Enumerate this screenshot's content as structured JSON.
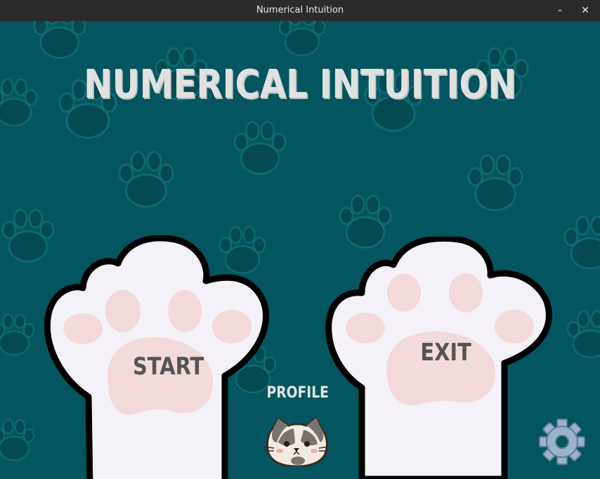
{
  "window": {
    "title": "Numerical Intuition",
    "minimize_label": "–",
    "close_label": "✕"
  },
  "game": {
    "title": "NUMERICAL INTUITION",
    "start_label": "START",
    "exit_label": "EXIT",
    "profile_label": "PROFILE"
  },
  "icons": {
    "avatar": "cat-face-icon",
    "settings": "gear-icon",
    "background": "paw-print-pattern"
  },
  "colors": {
    "background": "#03565f",
    "paw_print": "#034a52",
    "paw_outline": "#0e6a72",
    "title_text": "#e1e1e1",
    "paw_fill": "#f4f2f8",
    "paw_pad": "#f3dbdb",
    "label_text": "#555555",
    "gear": "#9ab3cc"
  }
}
